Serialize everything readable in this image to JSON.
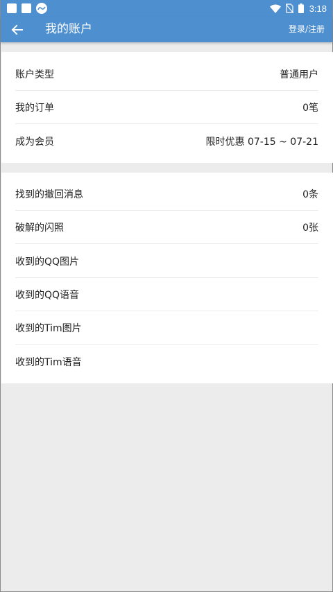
{
  "status_bar": {
    "time": "3:18",
    "icons": [
      "notification-square-icon",
      "notification-square-icon",
      "app-logo-icon",
      "wifi-icon",
      "no-sim-icon",
      "battery-icon"
    ]
  },
  "app_bar": {
    "back_icon": "arrow-left-icon",
    "title": "我的账户",
    "action_label": "登录/注册"
  },
  "account_section": [
    {
      "label": "账户类型",
      "value": "普通用户"
    },
    {
      "label": "我的订单",
      "value": "0笔"
    },
    {
      "label": "成为会员",
      "value": "限时优惠 07-15 ~ 07-21"
    }
  ],
  "records_section": [
    {
      "label": "找到的撤回消息",
      "value": "0条"
    },
    {
      "label": "破解的闪照",
      "value": "0张"
    },
    {
      "label": "收到的QQ图片",
      "value": ""
    },
    {
      "label": "收到的QQ语音",
      "value": ""
    },
    {
      "label": "收到的Tim图片",
      "value": ""
    },
    {
      "label": "收到的Tim语音",
      "value": ""
    }
  ],
  "colors": {
    "primary": "#4d8fcf",
    "background": "#ececec",
    "card": "#ffffff",
    "divider": "#ebebeb"
  }
}
